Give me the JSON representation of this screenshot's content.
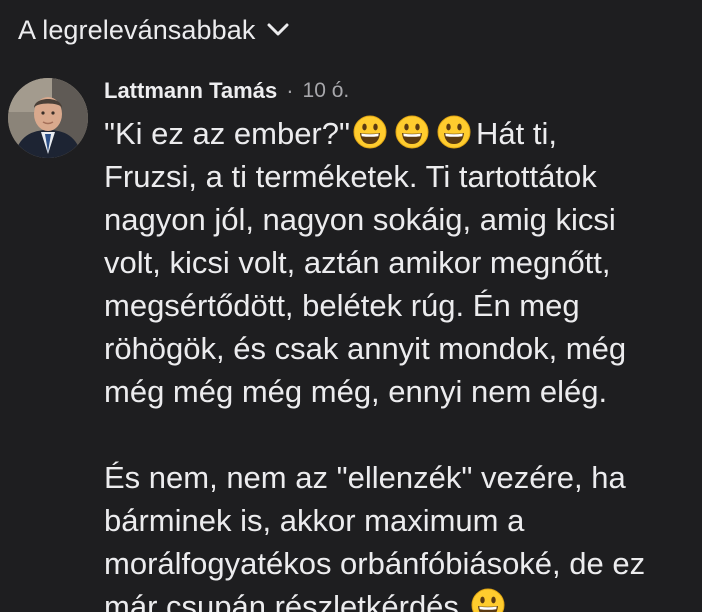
{
  "sort": {
    "label": "A legrelevánsabbak",
    "icon": "chevron-down-icon"
  },
  "comment": {
    "author": "Lattmann Tamás",
    "separator": "·",
    "time": "10 ó.",
    "avatar_icon": "profile-photo",
    "emoji_icon": "grinning-face-emoji",
    "lines": {
      "l1_text": "\"Ki ez az ember?\"",
      "l1_tail": "Hát ti,",
      "l2": "Fruzsi, a ti terméketek. Ti tartottátok",
      "l3": "nagyon jól, nagyon sokáig, amig kicsi",
      "l4": "volt, kicsi volt, aztán amikor megnőtt,",
      "l5": "megsértődött, belétek rúg. Én meg",
      "l6": "röhögök, és csak annyit mondok, még",
      "l7": "még még még még, ennyi nem elég.",
      "l8": "És nem, nem az \"ellenzék\" vezére, ha",
      "l9": "bárminek is, akkor maximum a",
      "l10": "morálfogyatékos orbánfóbiásoké, de ez",
      "l11": "már csupán részletkérdés."
    }
  },
  "colors": {
    "background": "#1e1e20",
    "text": "#ececee",
    "muted": "#a7a7ab",
    "emoji_face": "#ffcc2e"
  }
}
